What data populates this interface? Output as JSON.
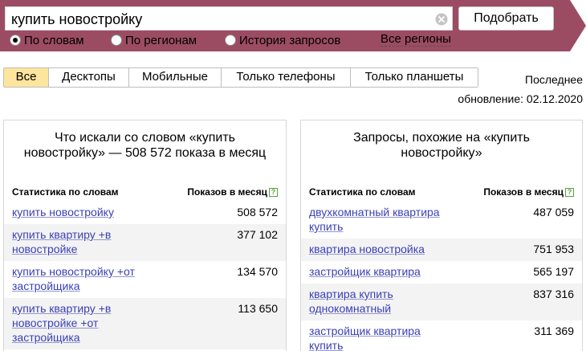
{
  "header": {
    "search_value": "купить новостройку",
    "submit_label": "Подобрать",
    "radios": [
      {
        "label": "По словам",
        "checked": true
      },
      {
        "label": "По регионам",
        "checked": false
      },
      {
        "label": "История запросов",
        "checked": false
      }
    ],
    "regions_link": "Все регионы",
    "bg_color": "#9b4c63"
  },
  "device_tabs": [
    "Все",
    "Десктопы",
    "Мобильные",
    "Только телефоны",
    "Только планшеты"
  ],
  "active_tab": "Все",
  "updated": {
    "line1": "Последнее",
    "line2": "обновление: 02.12.2020"
  },
  "left_panel": {
    "title": "Что искали со словом «купить новостройку» — 508 572 показа в месяц",
    "col_words": "Статистика по словам",
    "col_shows": "Показов в месяц",
    "rows": [
      {
        "query": "купить новостройку",
        "count": "508 572"
      },
      {
        "query": "купить квартиру +в новостройке",
        "count": "377 102"
      },
      {
        "query": "купить новостройку +от застройщика",
        "count": "134 570"
      },
      {
        "query": "купить квартиру +в новостройке +от застройщика",
        "count": "113 650"
      }
    ]
  },
  "right_panel": {
    "title": "Запросы, похожие на «купить новостройку»",
    "col_words": "Статистика по словам",
    "col_shows": "Показов в месяц",
    "rows": [
      {
        "query": "двухкомнатный квартира купить",
        "count": "487 059"
      },
      {
        "query": "квартира новостройка",
        "count": "751 953"
      },
      {
        "query": "застройщик квартира",
        "count": "565 197"
      },
      {
        "query": "квартира купить однокомнатный",
        "count": "837 316"
      },
      {
        "query": "застройщик квартира купить",
        "count": "311 369"
      }
    ]
  },
  "colors": {
    "link": "#3a3fb4",
    "active_tab": "#fde59d",
    "row_alt": "#f3f3f3"
  },
  "icons": {
    "clear": "clear-icon",
    "help": "help-icon"
  }
}
